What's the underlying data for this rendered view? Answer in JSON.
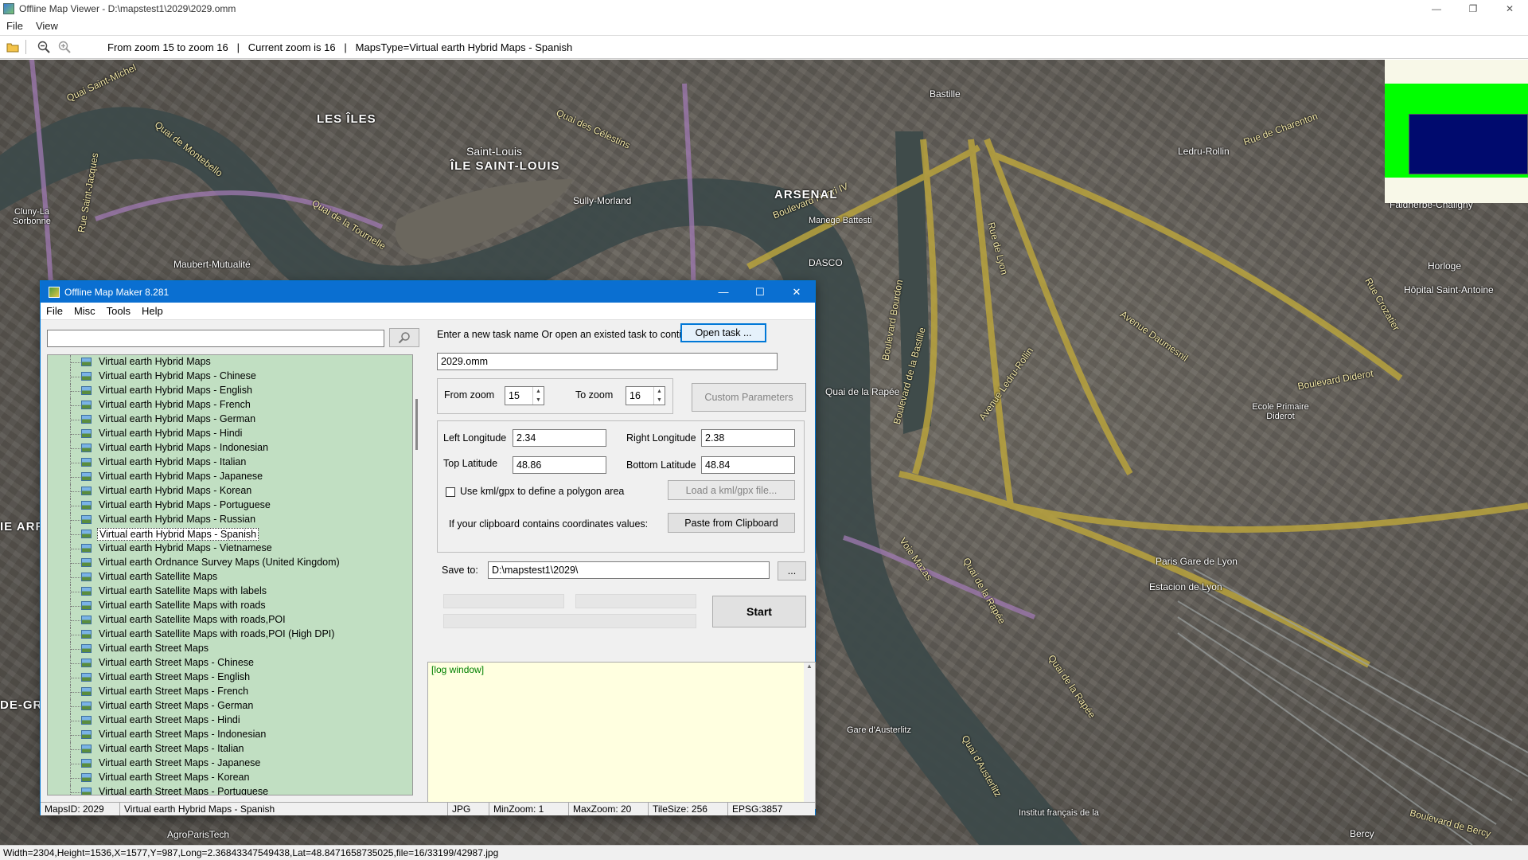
{
  "viewer": {
    "title": "Offline Map Viewer - D:\\mapstest1\\2029\\2029.omm",
    "window_buttons": [
      "—",
      "❐",
      "✕"
    ],
    "menu": [
      "File",
      "View"
    ],
    "toolbar": {
      "info": "From zoom 15 to zoom 16   |   Current zoom is 16   |   MapsType=Virtual earth Hybrid Maps - Spanish"
    },
    "status": "Width=2304,Height=1536,X=1577,Y=987,Long=2.36843347549438,Lat=48.8471658735025,file=16/33199/42987.jpg"
  },
  "map_labels": {
    "les_iles": "LES ÎLES",
    "saint_louis": "Saint-Louis",
    "ile_saint_louis": "ÎLE SAINT-LOUIS",
    "arsenal": "ARSENAL",
    "dasco": "DASCO",
    "quai_saint_michel": "Quai Saint-Michel",
    "quai_montebello": "Quai de Montebello",
    "quai_tournelle": "Quai de la Tournelle",
    "quai_celestins": "Quai des Célestins",
    "bd_henri_iv": "Boulevard Henri IV",
    "bd_bourdon": "Boulevard Bourdon",
    "bd_bastille": "Boulevard de la Bastille",
    "bastille": "Bastille",
    "rue_de_lyon": "Rue de Lyon",
    "av_ledru": "Avenue Ledru-Rollin",
    "av_daumesnil": "Avenue Daumesnil",
    "bd_diderot": "Boulevard Diderot",
    "quai_rapee": "Quai de la Rapée",
    "voie_mazas": "Voie Mazas",
    "paris_gare_lyon": "Paris Gare de Lyon",
    "estacion_lyon": "Estacion de Lyon",
    "gare_austerlitz": "Gare d'Austerlitz",
    "quai_austerlitz": "Quai d'Austerlitz",
    "bd_bercy": "Boulevard de Bercy",
    "bercy": "Bercy",
    "sully_morland": "Sully-Morland",
    "ledru_rollin": "Ledru-Rollin",
    "faidherbe": "Faidherbe-Chaligny",
    "maubert": "Maubert-Mutualité",
    "cluny": "Cluny-La Sorbonne",
    "agroparistech": "AgroParisTech",
    "institut": "Institut français de la",
    "quai_rapee_station": "Quai de la Rapée",
    "hopital": "Hôpital Saint-Antoine",
    "horloge": "Horloge",
    "ecole": "Ecole Primaire Diderot",
    "manege": "Manege Battesti",
    "rue_saint_jacques": "Rue Saint-Jacques",
    "ie_arr": "IE ARR",
    "de_gr": "DE-GR",
    "rue_crozatier": "Rue Crozatier",
    "rue_charenton": "Rue de Charenton"
  },
  "maker": {
    "title": "Offline Map Maker 8.281",
    "menu": [
      "File",
      "Misc",
      "Tools",
      "Help"
    ],
    "search_value": "",
    "tree_items": [
      "Virtual earth Hybrid Maps",
      "Virtual earth Hybrid Maps - Chinese",
      "Virtual earth Hybrid Maps - English",
      "Virtual earth Hybrid Maps - French",
      "Virtual earth Hybrid Maps - German",
      "Virtual earth Hybrid Maps - Hindi",
      "Virtual earth Hybrid Maps - Indonesian",
      "Virtual earth Hybrid Maps - Italian",
      "Virtual earth Hybrid Maps - Japanese",
      "Virtual earth Hybrid Maps - Korean",
      "Virtual earth Hybrid Maps - Portuguese",
      "Virtual earth Hybrid Maps - Russian",
      "Virtual earth Hybrid Maps - Spanish",
      "Virtual earth Hybrid Maps - Vietnamese",
      "Virtual earth Ordnance Survey Maps (United Kingdom)",
      "Virtual earth Satellite Maps",
      "Virtual earth Satellite Maps with labels",
      "Virtual earth Satellite Maps with roads",
      "Virtual earth Satellite Maps with roads,POI",
      "Virtual earth Satellite Maps with roads,POI (High DPI)",
      "Virtual earth Street Maps",
      "Virtual earth Street Maps - Chinese",
      "Virtual earth Street Maps - English",
      "Virtual earth Street Maps - French",
      "Virtual earth Street Maps - German",
      "Virtual earth Street Maps - Hindi",
      "Virtual earth Street Maps - Indonesian",
      "Virtual earth Street Maps - Italian",
      "Virtual earth Street Maps - Japanese",
      "Virtual earth Street Maps - Korean",
      "Virtual earth Street Maps - Portuguese"
    ],
    "selected_index": 12,
    "task_prompt": "Enter a new task name Or open an existed task to continue:",
    "open_task": "Open task ...",
    "task_name": "2029.omm",
    "from_zoom_label": "From zoom",
    "from_zoom": "15",
    "to_zoom_label": "To zoom",
    "to_zoom": "16",
    "custom_params": "Custom Parameters",
    "left_lon_label": "Left Longitude",
    "left_lon": "2.34",
    "right_lon_label": "Right Longitude",
    "right_lon": "2.38",
    "top_lat_label": "Top Latitude",
    "top_lat": "48.86",
    "bottom_lat_label": "Bottom Latitude",
    "bottom_lat": "48.84",
    "kml_label": "Use kml/gpx to define a polygon area",
    "load_kml": "Load a kml/gpx file...",
    "clipboard_label": "If your clipboard contains coordinates values:",
    "paste_btn": "Paste from Clipboard",
    "save_to_label": "Save to:",
    "save_to": "D:\\mapstest1\\2029\\",
    "browse": "...",
    "start": "Start",
    "log_text": "[log window]",
    "status": {
      "maps_id": "MapsID: 2029",
      "maps_name": "Virtual earth Hybrid Maps - Spanish",
      "format": "JPG",
      "min_zoom": "MinZoom: 1",
      "max_zoom": "MaxZoom: 20",
      "tile_size": "TileSize: 256",
      "epsg": "EPSG:3857"
    }
  },
  "colors": {
    "titlebar_active": "#0a6fd1",
    "tree_bg": "#c1dfc2",
    "log_bg": "#ffffe0",
    "overview_green": "#00ff00",
    "overview_navy": "#000a6e"
  },
  "icons": [
    "app-icon",
    "open-folder-icon",
    "zoom-out-icon",
    "zoom-in-icon",
    "search-icon",
    "map-type-icon"
  ]
}
